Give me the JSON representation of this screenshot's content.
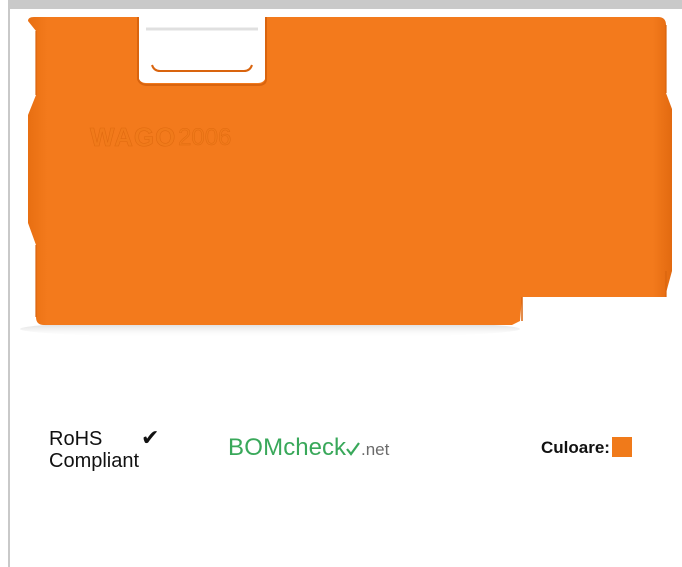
{
  "product": {
    "image_name": "orange-end-plate",
    "logo_text": "WAGO",
    "model_number": "2006",
    "color": "#f07a1a"
  },
  "badges": {
    "rohs_line1": "RoHS",
    "rohs_line2": "Compliant",
    "rohs_check_icon": "checkmark-icon",
    "bomcheck_main": "BOM",
    "bomcheck_check": "check",
    "bomcheck_tld": ".net",
    "bomcheck_color": "#39a85a"
  },
  "color_info": {
    "label": "Culoare:",
    "swatch_color": "#f07a1a"
  },
  "colors": {
    "frame": "#c9c9c9",
    "background": "#ffffff"
  }
}
